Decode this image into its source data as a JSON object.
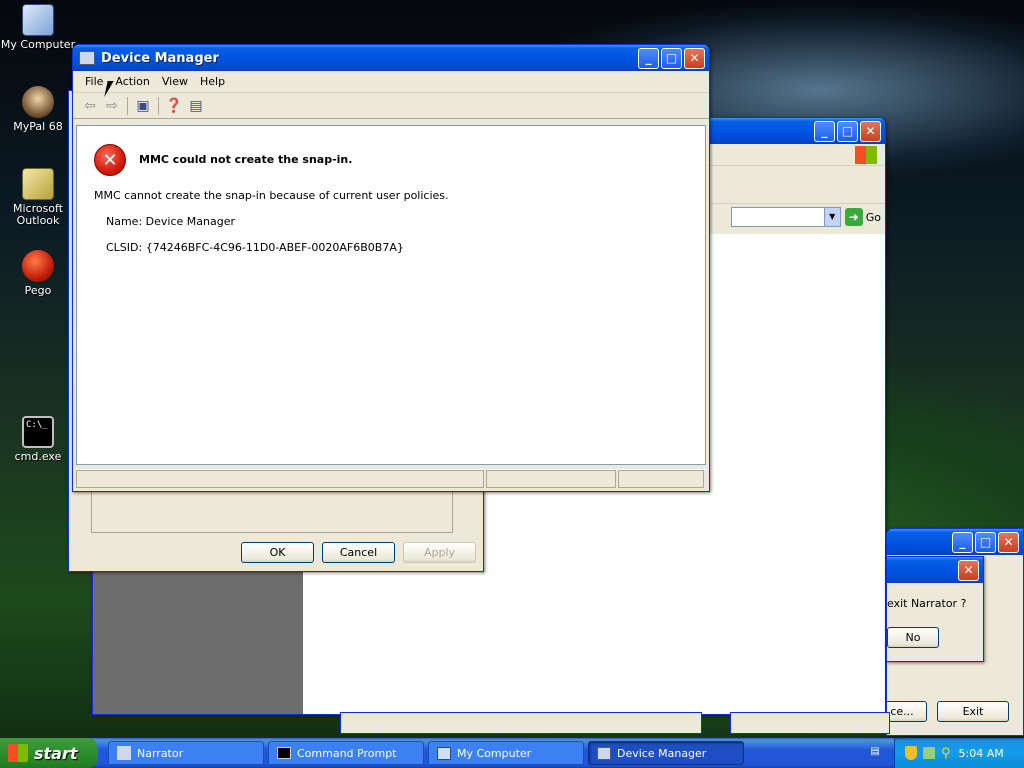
{
  "desktop": {
    "icons": [
      {
        "label": "My Computer"
      },
      {
        "label": "MyPal 68"
      },
      {
        "label": "Microsoft Outlook"
      },
      {
        "label": "Pego"
      },
      {
        "label": "cmd.exe"
      }
    ]
  },
  "dm": {
    "title": "Device Manager",
    "menu": [
      "File",
      "Action",
      "View",
      "Help"
    ],
    "error_title": "MMC could not create the snap-in.",
    "error_msg": "MMC cannot create the snap-in because of current user policies.",
    "name_line": "Name: Device Manager",
    "clsid_line": "CLSID: {74246BFC-4C96-11D0-ABEF-0020AF6B0B7A}"
  },
  "props_dialog": {
    "ok": "OK",
    "cancel": "Cancel",
    "apply": "Apply"
  },
  "explorer": {
    "go": "Go"
  },
  "narrator": {
    "prompt": "exit Narrator ?",
    "no": "No",
    "exit": "Exit",
    "partial_button": "ce..."
  },
  "taskbar": {
    "start": "start",
    "items": [
      {
        "label": "Narrator",
        "icon": "narrator-icon"
      },
      {
        "label": "Command Prompt",
        "icon": "cmd-icon"
      },
      {
        "label": "My Computer",
        "icon": "computer-icon"
      },
      {
        "label": "Device Manager",
        "icon": "device-manager-icon",
        "active": true
      }
    ],
    "clock": "5:04 AM"
  }
}
